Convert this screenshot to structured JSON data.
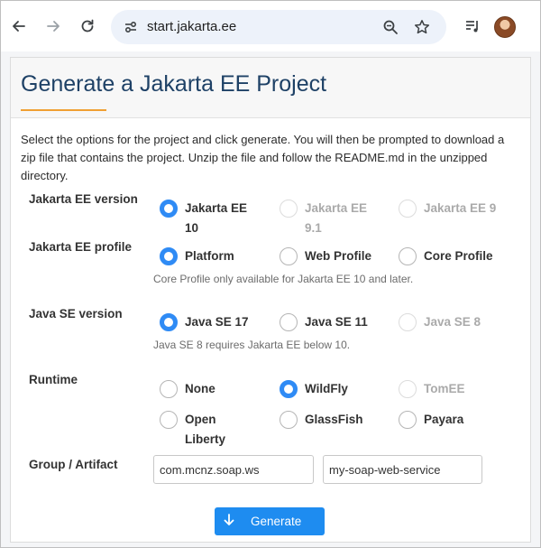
{
  "browser": {
    "url": "start.jakarta.ee",
    "icons": [
      "back-icon",
      "forward-icon",
      "reload-icon",
      "site-settings-icon",
      "zoom-icon",
      "bookmark-star-icon",
      "media-queue-icon",
      "profile-avatar"
    ]
  },
  "page": {
    "title": "Generate a Jakarta EE Project",
    "intro": "Select the options for the project and click generate. You will then be prompted to download a zip file that contains the project. Unzip the file and follow the README.md in the unzipped directory."
  },
  "form": {
    "jakarta_version": {
      "label": "Jakarta EE version",
      "options": [
        {
          "label": "Jakarta EE 10",
          "checked": true,
          "disabled": false
        },
        {
          "label": "Jakarta EE 9.1",
          "checked": false,
          "disabled": true
        },
        {
          "label": "Jakarta EE 9",
          "checked": false,
          "disabled": true
        }
      ]
    },
    "profile": {
      "label": "Jakarta EE profile",
      "options": [
        {
          "label": "Platform",
          "checked": true,
          "disabled": false
        },
        {
          "label": "Web Profile",
          "checked": false,
          "disabled": false
        },
        {
          "label": "Core Profile",
          "checked": false,
          "disabled": false
        }
      ],
      "hint": "Core Profile only available for Jakarta EE 10 and later."
    },
    "java_se": {
      "label": "Java SE version",
      "options": [
        {
          "label": "Java SE 17",
          "checked": true,
          "disabled": false
        },
        {
          "label": "Java SE 11",
          "checked": false,
          "disabled": false
        },
        {
          "label": "Java SE 8",
          "checked": false,
          "disabled": true
        }
      ],
      "hint": "Java SE 8 requires Jakarta EE below 10."
    },
    "runtime": {
      "label": "Runtime",
      "options": [
        {
          "label": "None",
          "checked": false,
          "disabled": false
        },
        {
          "label": "WildFly",
          "checked": true,
          "disabled": false
        },
        {
          "label": "TomEE",
          "checked": false,
          "disabled": true
        },
        {
          "label": "Open Liberty",
          "checked": false,
          "disabled": false
        },
        {
          "label": "GlassFish",
          "checked": false,
          "disabled": false
        },
        {
          "label": "Payara",
          "checked": false,
          "disabled": false
        }
      ]
    },
    "group_artifact": {
      "label": "Group / Artifact",
      "group": "com.mcnz.soap.ws",
      "artifact": "my-soap-web-service"
    },
    "generate_label": "Generate"
  },
  "colors": {
    "accent": "#1e8cf0",
    "title": "#1e4166",
    "underline": "#f0a033"
  }
}
